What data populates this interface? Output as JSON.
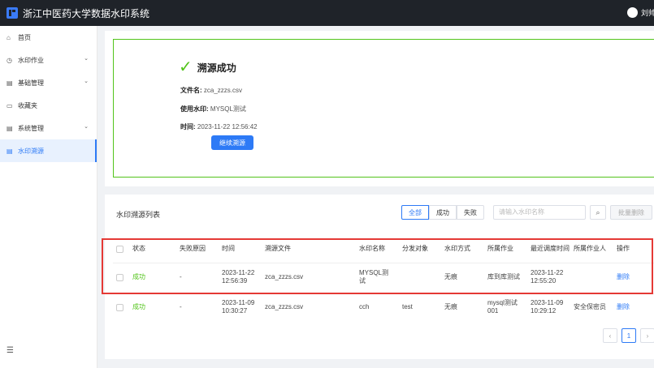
{
  "app": {
    "title": "浙江中医药大学数据水印系统",
    "user": "刘帅"
  },
  "sidebar": {
    "items": [
      {
        "label": "首页",
        "icon": "home-icon"
      },
      {
        "label": "水印作业",
        "icon": "clock-icon"
      },
      {
        "label": "基础管理",
        "icon": "doc-icon"
      },
      {
        "label": "收藏夹",
        "icon": "folder-icon"
      },
      {
        "label": "系统管理",
        "icon": "doc-icon"
      },
      {
        "label": "水印溯源",
        "icon": "doc-icon"
      }
    ]
  },
  "result": {
    "title": "溯源成功",
    "filename_label": "文件名:",
    "filename": "zca_zzzs.csv",
    "watermark_label": "使用水印:",
    "watermark": "MYSQL测试",
    "time_label": "时间:",
    "time": "2023-11-22 12:56:42",
    "continue_button": "继续溯源"
  },
  "list": {
    "title": "水印溯源列表",
    "filters": {
      "all": "全部",
      "success": "成功",
      "fail": "失败"
    },
    "search_placeholder": "请输入水印名称",
    "batch_delete": "批量删除",
    "columns": {
      "status": "状态",
      "reason": "失败原因",
      "time": "时间",
      "file": "溯源文件",
      "wm_name": "水印名称",
      "target": "分发对象",
      "method": "水印方式",
      "job": "所属作业",
      "recent": "最近调度时间",
      "owner": "所属作业人",
      "action": "操作"
    },
    "rows": [
      {
        "status": "成功",
        "reason": "-",
        "time": "2023-11-22 12:56:39",
        "file": "zca_zzzs.csv",
        "wm_name": "MYSQL测试",
        "target": "",
        "method": "无痕",
        "job": "库到库测试",
        "recent": "2023-11-22 12:55:20",
        "owner": "",
        "action": "删除"
      },
      {
        "status": "成功",
        "reason": "-",
        "time": "2023-11-09 10:30:27",
        "file": "zca_zzzs.csv",
        "wm_name": "cch",
        "target": "test",
        "method": "无痕",
        "job": "mysql测试001",
        "recent": "2023-11-09 10:29:12",
        "owner": "安全保密员",
        "action": "删除"
      }
    ],
    "pagination": {
      "current": "1"
    }
  }
}
